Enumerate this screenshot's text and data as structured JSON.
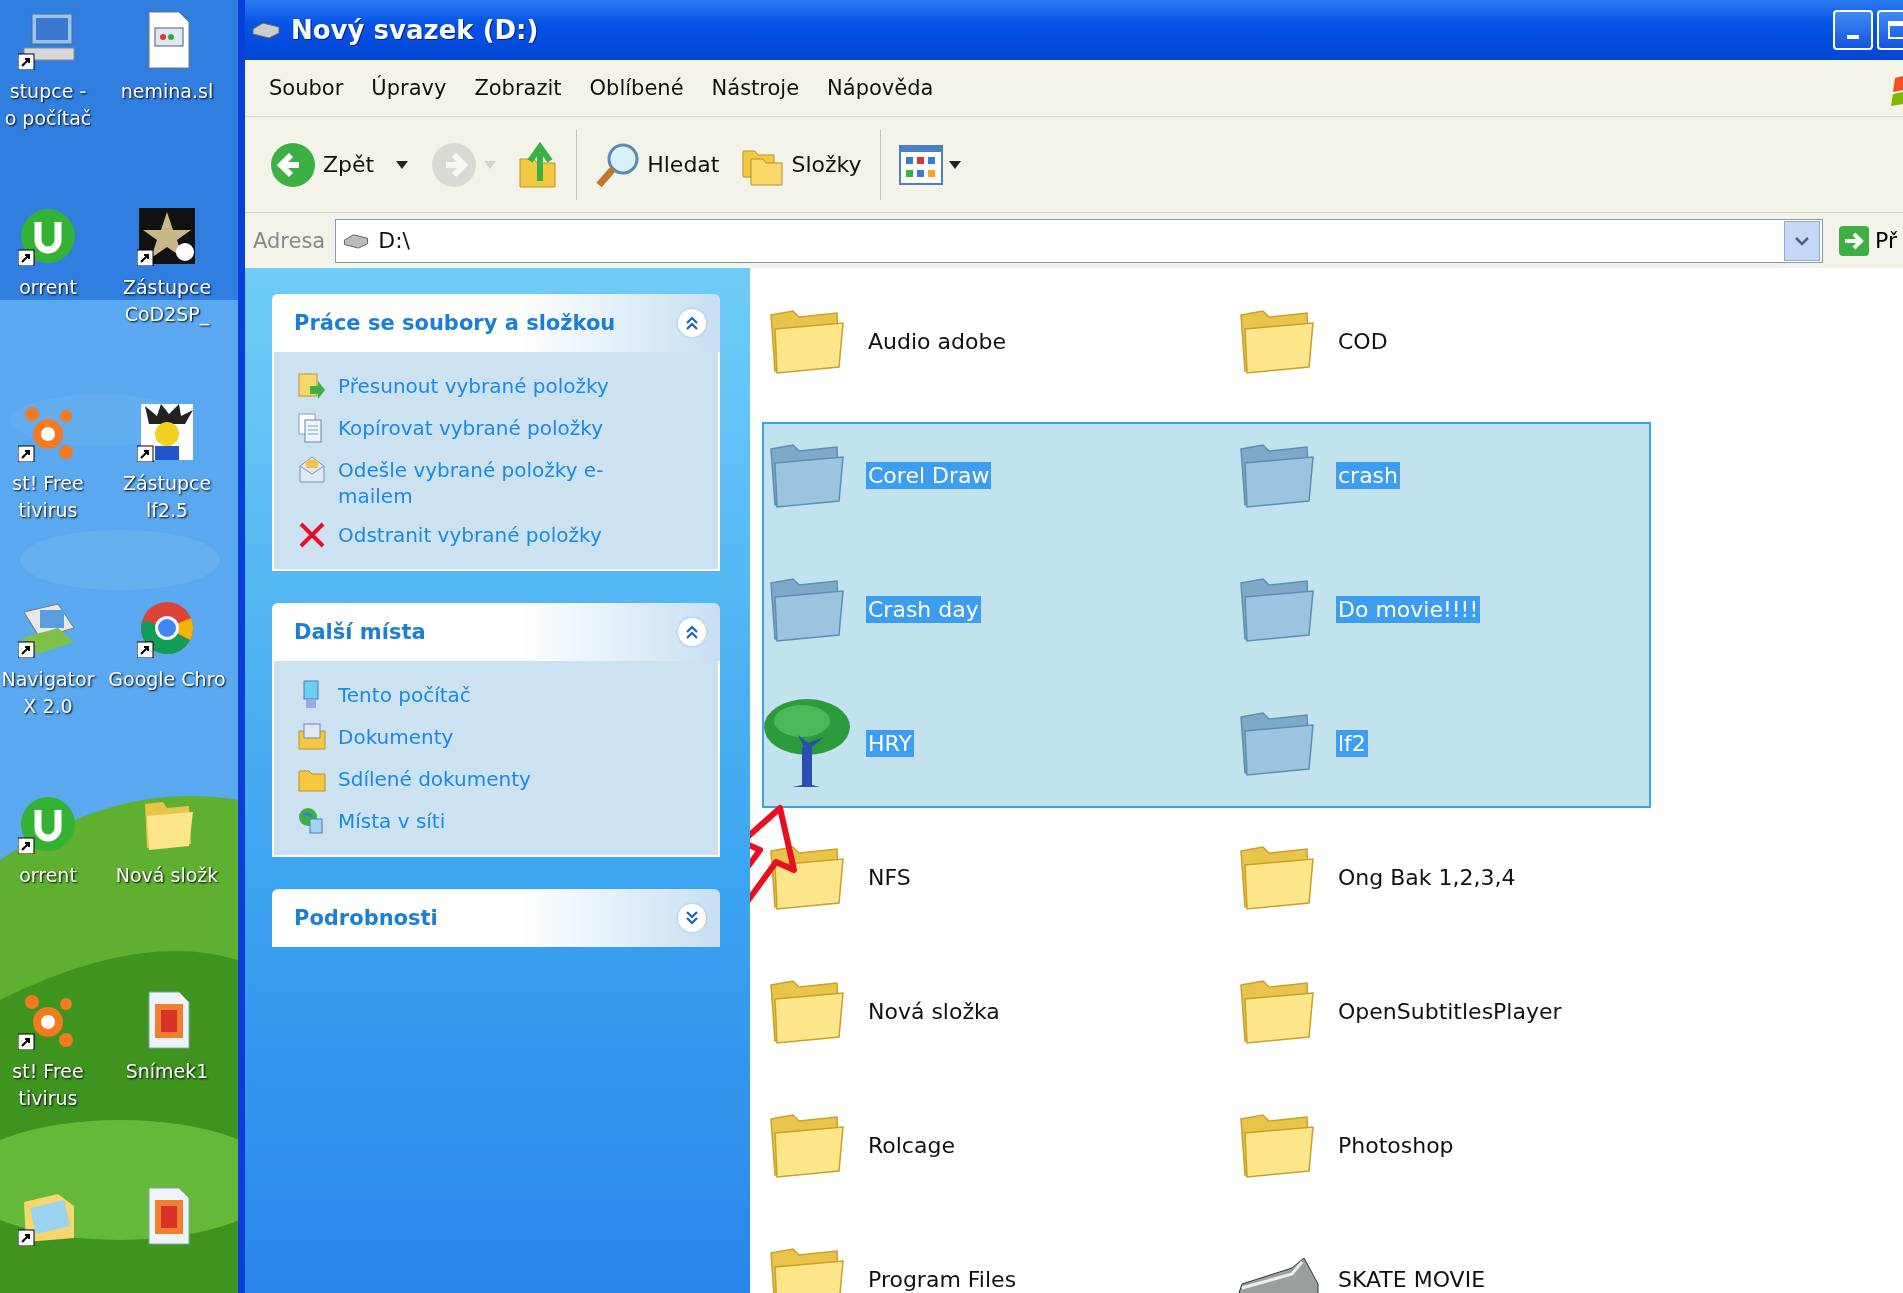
{
  "desktop": {
    "wallpaper": {
      "kind": "picture"
    },
    "columns": [
      [
        {
          "kind": "computer",
          "label": [
            "stupce -",
            "o počítač"
          ],
          "shortcut": true
        },
        {
          "kind": "torrent",
          "label": [
            "orrent"
          ],
          "shortcut": true
        },
        {
          "kind": "antivirus",
          "label": [
            "st! Free",
            "tivirus"
          ],
          "shortcut": true
        },
        {
          "kind": "navigator",
          "label": [
            "Navigator",
            "X 2.0"
          ],
          "shortcut": true
        },
        {
          "kind": "torrent",
          "label": [
            "orrent"
          ],
          "shortcut": true
        },
        {
          "kind": "antivirus",
          "label": [
            "st! Free",
            "tivirus"
          ],
          "shortcut": true
        },
        {
          "kind": "photo-folder",
          "shortcut": true
        }
      ],
      [
        {
          "kind": "document",
          "label": [
            "nemina.sl"
          ],
          "shortcut": false
        },
        {
          "kind": "star",
          "label": [
            "Zástupce",
            "CoD2SP_"
          ],
          "shortcut": true
        },
        {
          "kind": "cartoon",
          "label": [
            "Zástupce",
            "lf2.5"
          ],
          "shortcut": true
        },
        {
          "kind": "browser",
          "label": [
            "Google Chro"
          ],
          "shortcut": true
        },
        {
          "kind": "folder",
          "label": [
            "Nová složk"
          ],
          "shortcut": false
        },
        {
          "kind": "image-doc",
          "label": [
            "Snímek1"
          ],
          "shortcut": false
        },
        {
          "kind": "image-doc",
          "shortcut": false
        }
      ]
    ]
  },
  "window": {
    "title": "Nový svazek (D:)",
    "menu": [
      "Soubor",
      "Úpravy",
      "Zobrazit",
      "Oblíbené",
      "Nástroje",
      "Nápověda"
    ],
    "toolbar": [
      {
        "kind": "back",
        "label": "Zpět",
        "disabled": false
      },
      {
        "kind": "forward",
        "disabled": true
      },
      {
        "kind": "up"
      },
      {
        "kind": "separator"
      },
      {
        "kind": "search",
        "label": "Hledat"
      },
      {
        "kind": "folders",
        "label": "Složky"
      },
      {
        "kind": "separator"
      },
      {
        "kind": "views"
      }
    ],
    "address": {
      "label": "Adresa",
      "value": "D:\\",
      "go_label": "Př"
    }
  },
  "task_panels": [
    {
      "title": "Práce se soubory a složkou",
      "expanded": true,
      "items": [
        {
          "kind": "move",
          "label": "Přesunout vybrané položky"
        },
        {
          "kind": "copy",
          "label": "Kopírovat vybrané položky"
        },
        {
          "kind": "email",
          "label": "Odešle vybrané položky e-mailem"
        },
        {
          "kind": "delete",
          "label": "Odstranit vybrané položky"
        }
      ]
    },
    {
      "title": "Další místa",
      "expanded": true,
      "items": [
        {
          "kind": "computer",
          "label": "Tento počítač"
        },
        {
          "kind": "documents",
          "label": "Dokumenty"
        },
        {
          "kind": "folder",
          "label": "Sdílené dokumenty"
        },
        {
          "kind": "network",
          "label": "Místa v síti"
        }
      ]
    },
    {
      "title": "Podrobnosti",
      "expanded": false
    }
  ],
  "files": [
    {
      "name": "Audio adobe",
      "kind": "folder",
      "selected": false
    },
    {
      "name": "COD",
      "kind": "folder",
      "selected": false
    },
    {
      "name": "Corel Draw",
      "kind": "folder",
      "selected": true
    },
    {
      "name": "crash",
      "kind": "folder",
      "selected": true
    },
    {
      "name": "Crash day",
      "kind": "folder",
      "selected": true
    },
    {
      "name": "Do movie!!!!",
      "kind": "folder",
      "selected": true
    },
    {
      "name": "HRY",
      "kind": "tree",
      "selected": true
    },
    {
      "name": "lf2",
      "kind": "folder",
      "selected": true
    },
    {
      "name": "NFS",
      "kind": "folder",
      "selected": false
    },
    {
      "name": "Ong Bak 1,2,3,4",
      "kind": "folder",
      "selected": false
    },
    {
      "name": "Nová složka",
      "kind": "folder",
      "selected": false
    },
    {
      "name": "OpenSubtitlesPlayer",
      "kind": "folder",
      "selected": false
    },
    {
      "name": "Rolcage",
      "kind": "folder",
      "selected": false
    },
    {
      "name": "Photoshop",
      "kind": "folder",
      "selected": false
    },
    {
      "name": "Program Files",
      "kind": "folder",
      "selected": false
    },
    {
      "name": "SKATE MOVIE",
      "kind": "skate",
      "selected": false
    }
  ]
}
